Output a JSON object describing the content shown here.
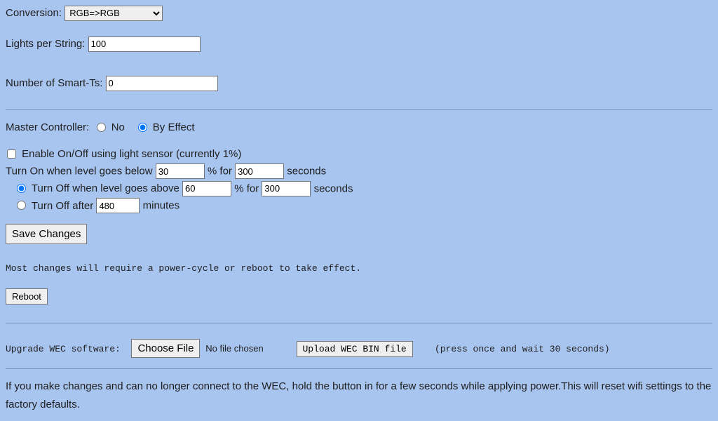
{
  "conversion": {
    "label": "Conversion:",
    "selected": "RGB=>RGB"
  },
  "lights_per_string": {
    "label": "Lights per String:",
    "value": "100"
  },
  "smart_ts": {
    "label": "Number of Smart-Ts:",
    "value": "0"
  },
  "master_controller": {
    "label": "Master Controller:",
    "option_no": "No",
    "option_by_effect": "By Effect"
  },
  "light_sensor": {
    "enable_label": "Enable On/Off using light sensor (currently 1%)",
    "turn_on_pre": "Turn On when level goes below ",
    "turn_on_level": "30",
    "percent_for": "% for ",
    "turn_on_seconds": "300",
    "seconds_label": "seconds",
    "turn_off_above_pre": "Turn Off when level goes above ",
    "turn_off_level": "60",
    "turn_off_seconds": "300",
    "turn_off_after_pre": "Turn Off after ",
    "turn_off_after_min": "480",
    "minutes_label": "minutes"
  },
  "buttons": {
    "save": "Save Changes",
    "reboot": "Reboot",
    "choose_file": "Choose File",
    "upload": "Upload WEC BIN file"
  },
  "notes": {
    "power_cycle": "Most changes will require a power-cycle or reboot to take effect.",
    "upgrade_label": "Upgrade WEC software:",
    "no_file": "No file chosen",
    "press_once": "(press once and wait 30 seconds)",
    "reset_help": "If you make changes and can no longer connect to the WEC, hold the button in for a few seconds while applying power.This will reset wifi settings to the factory defaults."
  }
}
